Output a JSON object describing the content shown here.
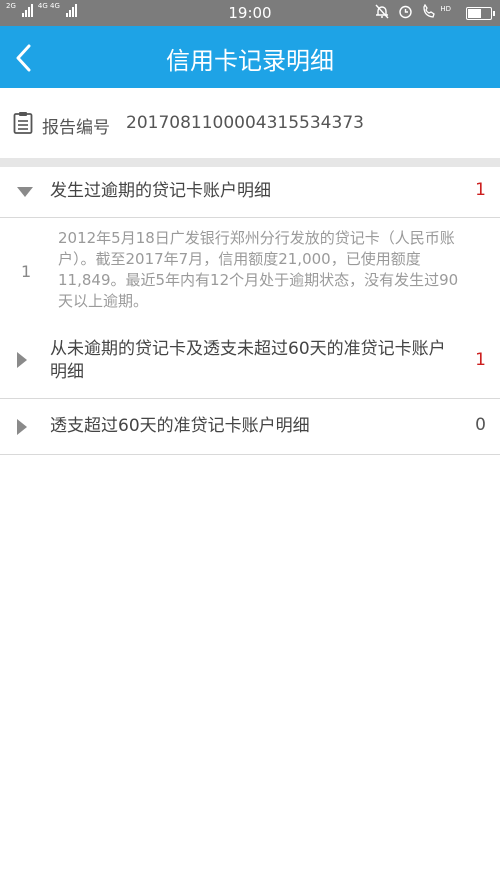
{
  "status_bar": {
    "network_left": "2G",
    "network_right": "4G 4G",
    "time": "19:00",
    "hd_label": "HD",
    "battery_level": 0.6
  },
  "header": {
    "title": "信用卡记录明细"
  },
  "report": {
    "label": "报告编号",
    "number": "2017081100004315534373"
  },
  "sections": [
    {
      "title": "发生过逾期的贷记卡账户明细",
      "count": "1",
      "expanded": true,
      "items": [
        {
          "index": "1",
          "text": "2012年5月18日广发银行郑州分行发放的贷记卡（人民币账户）。截至2017年7月，信用额度21,000，已使用额度11,849。最近5年内有12个月处于逾期状态，没有发生过90天以上逾期。"
        }
      ]
    },
    {
      "title": "从未逾期的贷记卡及透支未超过60天的准贷记卡账户明细",
      "count": "1",
      "expanded": false
    },
    {
      "title": "透支超过60天的准贷记卡账户明细",
      "count": "0",
      "expanded": false
    }
  ],
  "colors": {
    "header_bg": "#1ea3e6",
    "count_red": "#cc1f1f",
    "status_bar_bg": "#7c7c7c"
  }
}
